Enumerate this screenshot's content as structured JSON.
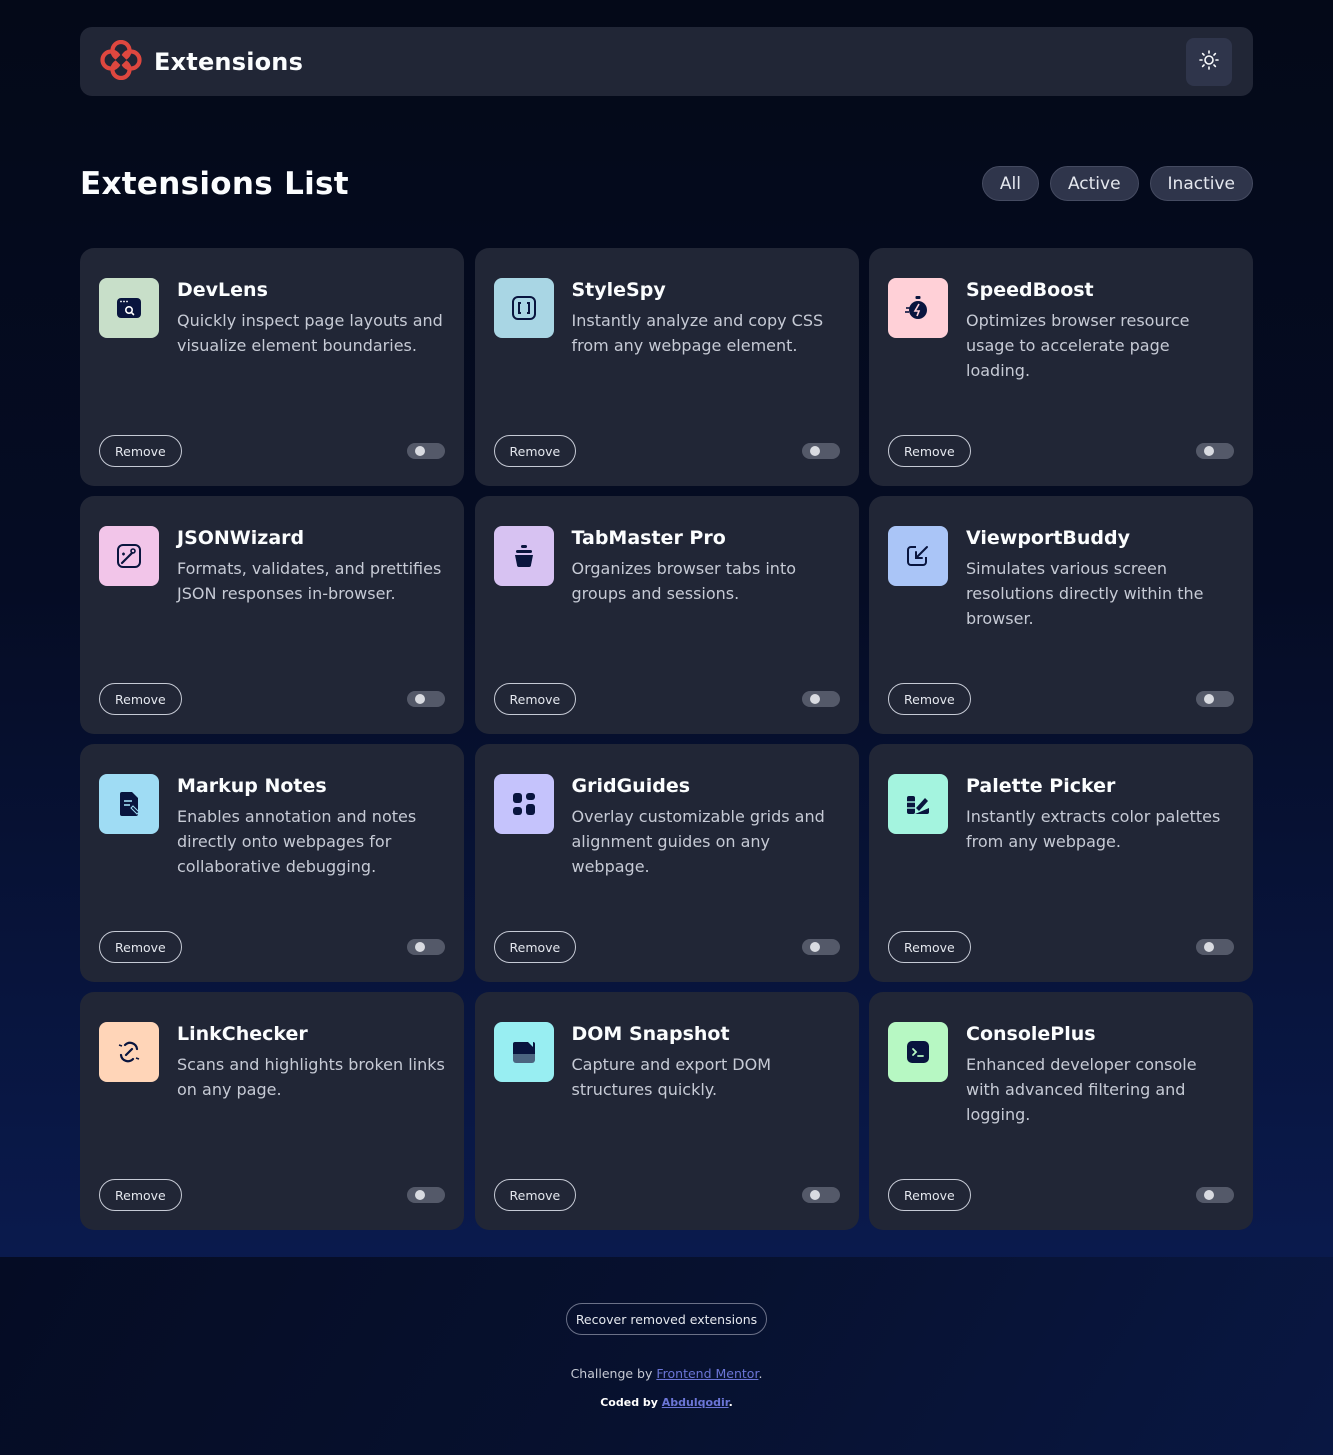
{
  "header": {
    "brand_name": "Extensions",
    "theme_icon": "sun-icon",
    "logo_color": "#de473f"
  },
  "list": {
    "title": "Extensions List",
    "filters": [
      {
        "label": "All"
      },
      {
        "label": "Active"
      },
      {
        "label": "Inactive"
      }
    ]
  },
  "extensions": [
    {
      "name": "DevLens",
      "description": "Quickly inspect page layouts and visualize element boundaries.",
      "icon": "devlens-icon",
      "icon_bg": "#c8dfc9",
      "remove_label": "Remove",
      "active": false
    },
    {
      "name": "StyleSpy",
      "description": "Instantly analyze and copy CSS from any webpage element.",
      "icon": "stylespy-icon",
      "icon_bg": "#a9d6e4",
      "remove_label": "Remove",
      "active": false
    },
    {
      "name": "SpeedBoost",
      "description": "Optimizes browser resource usage to accelerate page loading.",
      "icon": "speedboost-icon",
      "icon_bg": "#ffd0d7",
      "remove_label": "Remove",
      "active": false
    },
    {
      "name": "JSONWizard",
      "description": "Formats, validates, and prettifies JSON responses in-browser.",
      "icon": "jsonwizard-icon",
      "icon_bg": "#f2c5e9",
      "remove_label": "Remove",
      "active": false
    },
    {
      "name": "TabMaster Pro",
      "description": "Organizes browser tabs into groups and sessions.",
      "icon": "tabmaster-icon",
      "icon_bg": "#d7c2f2",
      "remove_label": "Remove",
      "active": false
    },
    {
      "name": "ViewportBuddy",
      "description": "Simulates various screen resolutions directly within the browser.",
      "icon": "viewportbuddy-icon",
      "icon_bg": "#aac5f7",
      "remove_label": "Remove",
      "active": false
    },
    {
      "name": "Markup Notes",
      "description": "Enables annotation and notes directly onto webpages for collaborative debugging.",
      "icon": "markupnotes-icon",
      "icon_bg": "#9fdcf4",
      "remove_label": "Remove",
      "active": false
    },
    {
      "name": "GridGuides",
      "description": "Overlay customizable grids and alignment guides on any webpage.",
      "icon": "gridguides-icon",
      "icon_bg": "#c5c3fc",
      "remove_label": "Remove",
      "active": false
    },
    {
      "name": "Palette Picker",
      "description": "Instantly extracts color palettes from any webpage.",
      "icon": "palettepicker-icon",
      "icon_bg": "#a4f4df",
      "remove_label": "Remove",
      "active": false
    },
    {
      "name": "LinkChecker",
      "description": "Scans and highlights broken links on any page.",
      "icon": "linkchecker-icon",
      "icon_bg": "#ffd5b8",
      "remove_label": "Remove",
      "active": false
    },
    {
      "name": "DOM Snapshot",
      "description": "Capture and export DOM structures quickly.",
      "icon": "domsnapshot-icon",
      "icon_bg": "#98eef2",
      "remove_label": "Remove",
      "active": false
    },
    {
      "name": "ConsolePlus",
      "description": "Enhanced developer console with advanced filtering and logging.",
      "icon": "consoleplus-icon",
      "icon_bg": "#b7f8c3",
      "remove_label": "Remove",
      "active": false
    }
  ],
  "footer": {
    "recover_label": "Recover removed extensions",
    "challenge_prefix": "Challenge by ",
    "challenge_link": "Frontend Mentor",
    "challenge_suffix": ".",
    "coded_prefix": "Coded by ",
    "coded_link": "Abdulqodir",
    "coded_suffix": "."
  }
}
